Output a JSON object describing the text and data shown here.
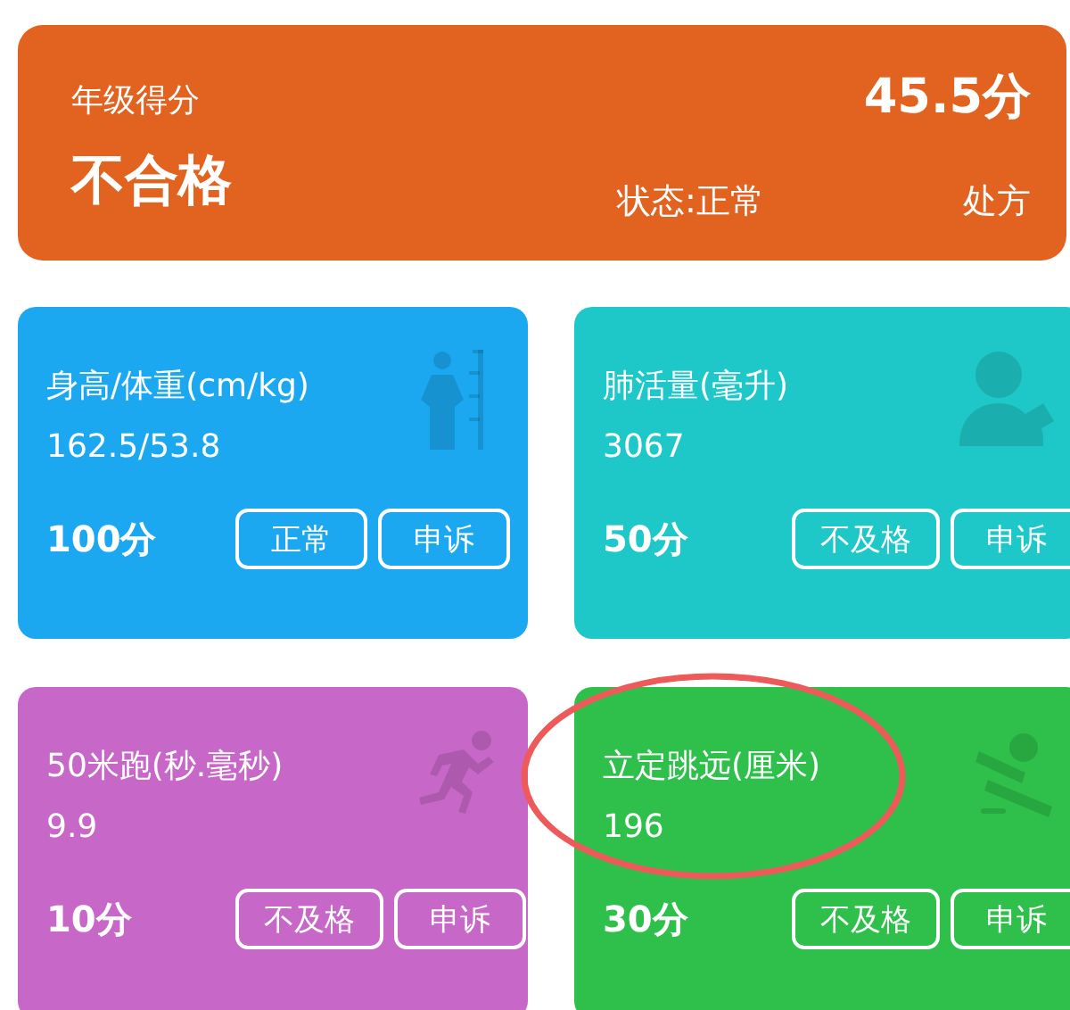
{
  "summary": {
    "label": "年级得分",
    "score": "45.5分",
    "grade": "不合格",
    "status": "状态:正常",
    "action": "处方"
  },
  "items": [
    {
      "kind": "height",
      "color": "#1ba8f1",
      "title": "身高/体重(cm/kg)",
      "value": "162.5/53.8",
      "score": "100分",
      "buttons": [
        "正常",
        "申诉"
      ]
    },
    {
      "kind": "lung",
      "color": "#1ec8c8",
      "title": "肺活量(毫升)",
      "value": "3067",
      "score": "50分",
      "buttons": [
        "不及格",
        "申诉"
      ]
    },
    {
      "kind": "run",
      "color": "#c768c8",
      "title": "50米跑(秒.毫秒)",
      "value": "9.9",
      "score": "10分",
      "buttons": [
        "不及格",
        "申诉"
      ]
    },
    {
      "kind": "jump",
      "color": "#2ec04b",
      "title": "立定跳远(厘米)",
      "value": "196",
      "score": "30分",
      "buttons": [
        "不及格",
        "申诉"
      ],
      "circled": true
    }
  ]
}
